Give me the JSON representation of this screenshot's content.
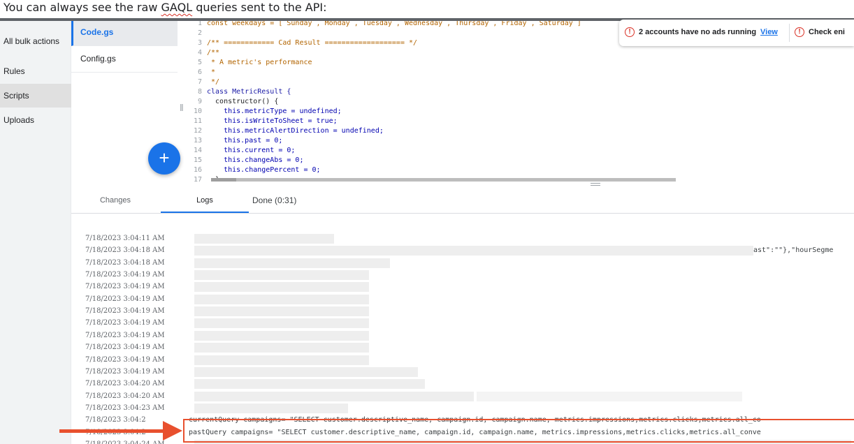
{
  "caption": {
    "prefix": "You can always see the raw ",
    "underlined": "GAQL",
    "suffix": " queries sent to the API:"
  },
  "colors": {
    "accent": "#1a73e8",
    "warning": "#d93025",
    "annotation": "#e8502e"
  },
  "sidebar": {
    "items": [
      {
        "label": "All bulk actions",
        "active": false
      },
      {
        "label": "Rules",
        "active": false
      },
      {
        "label": "Scripts",
        "active": true
      },
      {
        "label": "Uploads",
        "active": false
      }
    ]
  },
  "files": [
    {
      "label": "Code.gs",
      "active": true
    },
    {
      "label": "Config.gs",
      "active": false
    }
  ],
  "fab": {
    "icon": "plus-icon",
    "symbol": "+"
  },
  "editor": {
    "lines": [
      {
        "n": "1",
        "text": "const weekdays = [ Sunday , Monday , Tuesday , Wednesday , Thursday , Friday , Saturday ]",
        "style": "cm"
      },
      {
        "n": "2",
        "text": "",
        "style": "plain"
      },
      {
        "n": "3",
        "text": "/** ============ Cad Result =================== */",
        "style": "cm"
      },
      {
        "n": "4",
        "text": "/**",
        "style": "cm"
      },
      {
        "n": "5",
        "text": " * A metric's performance",
        "style": "cm"
      },
      {
        "n": "6",
        "text": " *",
        "style": "cm"
      },
      {
        "n": "7",
        "text": " */",
        "style": "cm"
      },
      {
        "n": "8",
        "text": "class MetricResult {",
        "style": "cls"
      },
      {
        "n": "9",
        "text": "  constructor() {",
        "style": "plain"
      },
      {
        "n": "10",
        "text": "    this.metricType = undefined;",
        "style": "kw"
      },
      {
        "n": "11",
        "text": "    this.isWriteToSheet = true;",
        "style": "kw"
      },
      {
        "n": "12",
        "text": "    this.metricAlertDirection = undefined;",
        "style": "kw"
      },
      {
        "n": "13",
        "text": "    this.past = 0;",
        "style": "kw"
      },
      {
        "n": "14",
        "text": "    this.current = 0;",
        "style": "kw"
      },
      {
        "n": "15",
        "text": "    this.changeAbs = 0;",
        "style": "kw"
      },
      {
        "n": "16",
        "text": "    this.changePercent = 0;",
        "style": "kw"
      },
      {
        "n": "17",
        "text": "  }",
        "style": "plain"
      }
    ]
  },
  "notification": {
    "icon": "alert-circle-icon",
    "message": "2 accounts have no ads running",
    "link": "View",
    "second": "Check eni"
  },
  "tabs": [
    {
      "label": "Changes",
      "active": false
    },
    {
      "label": "Logs",
      "active": true
    }
  ],
  "run_status": "Done (0:31)",
  "logs": [
    {
      "ts": "7/18/2023 3:04:11 AM",
      "msg": ""
    },
    {
      "ts": "7/18/2023 3:04:18 AM",
      "msg": "",
      "tail": "ast\":\"\"},\"hourSegme"
    },
    {
      "ts": "7/18/2023 3:04:18 AM",
      "msg": ""
    },
    {
      "ts": "7/18/2023 3:04:19 AM",
      "msg": ""
    },
    {
      "ts": "7/18/2023 3:04:19 AM",
      "msg": ""
    },
    {
      "ts": "7/18/2023 3:04:19 AM",
      "msg": ""
    },
    {
      "ts": "7/18/2023 3:04:19 AM",
      "msg": ""
    },
    {
      "ts": "7/18/2023 3:04:19 AM",
      "msg": ""
    },
    {
      "ts": "7/18/2023 3:04:19 AM",
      "msg": ""
    },
    {
      "ts": "7/18/2023 3:04:19 AM",
      "msg": ""
    },
    {
      "ts": "7/18/2023 3:04:19 AM",
      "msg": ""
    },
    {
      "ts": "7/18/2023 3:04:19 AM",
      "msg": ""
    },
    {
      "ts": "7/18/2023 3:04:20 AM",
      "msg": ""
    },
    {
      "ts": "7/18/2023 3:04:20 AM",
      "msg": ""
    },
    {
      "ts": "7/18/2023 3:04:23 AM",
      "msg": ""
    },
    {
      "ts": "7/18/2023 3:04:2",
      "msg": "currentQuery campaigns= \"SELECT customer.descriptive_name, campaign.id, campaign.name, metrics.impressions,metrics.clicks,metrics.all_co"
    },
    {
      "ts": "7/18/2023 3:04:2",
      "msg": "pastQuery campaigns= \"SELECT customer.descriptive_name, campaign.id, campaign.name, metrics.impressions,metrics.clicks,metrics.all_conve"
    },
    {
      "ts": "7/18/2023 3:04:24 AM",
      "msg": ""
    }
  ]
}
